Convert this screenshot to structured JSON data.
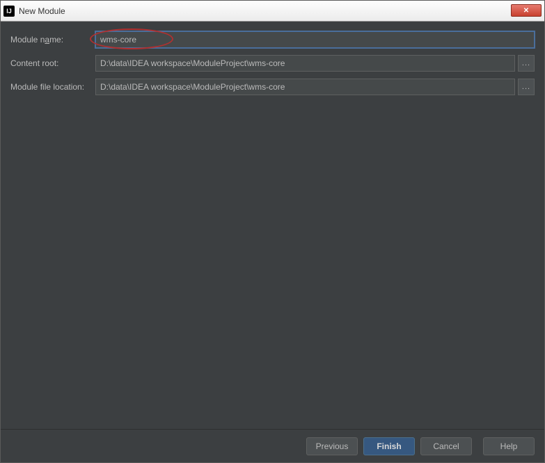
{
  "window": {
    "title": "New Module",
    "icon_text": "IJ"
  },
  "form": {
    "module_name": {
      "label_pre": "Module n",
      "label_underline": "a",
      "label_post": "me:",
      "value": "wms-core"
    },
    "content_root": {
      "label": "Content root:",
      "value": "D:\\data\\IDEA workspace\\ModuleProject\\wms-core",
      "browse": "..."
    },
    "module_file_location": {
      "label": "Module file location:",
      "value": "D:\\data\\IDEA workspace\\ModuleProject\\wms-core",
      "browse": "..."
    }
  },
  "buttons": {
    "previous": "Previous",
    "finish": "Finish",
    "cancel": "Cancel",
    "help": "Help"
  },
  "close_glyph": "✕"
}
